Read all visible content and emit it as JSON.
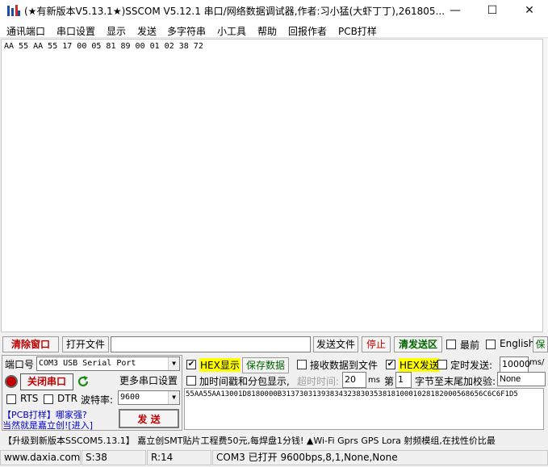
{
  "window": {
    "title": "(★有新版本V5.13.1★)SSCOM V5.12.1 串口/网络数据调试器,作者:习小猛(大虾丁丁),261805...",
    "minimize_glyph": "—",
    "maximize_glyph": "☐",
    "close_glyph": "✕"
  },
  "menu": {
    "items": [
      "通讯端口",
      "串口设置",
      "显示",
      "发送",
      "多字符串",
      "小工具",
      "帮助",
      "回报作者",
      "PCB打样"
    ]
  },
  "receive": {
    "text": "AA 55 AA 55 17 00 05 81 89 00 01 02 38 72"
  },
  "toolbar": {
    "clear_window": "清除窗口",
    "open_file": "打开文件",
    "file_path": "",
    "send_file": "发送文件",
    "stop": "停止",
    "clear_send": "清发送区",
    "top_most": "最前",
    "english": "English",
    "cut_label": "保"
  },
  "port_panel": {
    "port_label": "端口号",
    "port_value": "COM3 USB Serial Port",
    "close_port": "关闭串口",
    "more_settings": "更多串口设置",
    "rts": "RTS",
    "dtr": "DTR",
    "baud_label": "波特率:",
    "baud_value": "9600",
    "promo_line1": "【PCB打样】哪家强?",
    "promo_line2": "当然就是嘉立创![进入]",
    "send": "发  送"
  },
  "options": {
    "hex_display": "HEX显示",
    "save_data": "保存数据",
    "receive_to_file": "接收数据到文件",
    "hex_send": "HEX发送",
    "timed_send": "定时发送:",
    "timed_value": "10000",
    "timed_unit": "ms/",
    "timestamp": "加时间戳和分包显示,",
    "timeout_label": "超时时间:",
    "timeout_value": "20",
    "timeout_unit": "ms",
    "nth_label": "第",
    "nth_value": "1",
    "checksum_label": "字节至末尾加校验:",
    "checksum_value": "None"
  },
  "send_data": "55AA55AA13001D8180000B3137303139383432383035381810001028182000568656C6C6F1D5",
  "banner": "【升级到新版本SSCOM5.13.1】  嘉立创SMT贴片工程费50元,每焊盘1分钱! ▲Wi-Fi Gprs GPS Lora 射频模组,在找性价比最",
  "status": {
    "website": "www.daxia.com",
    "sent": "S:38",
    "received": "R:14",
    "port_state": "COM3 已打开  9600bps,8,1,None,None"
  }
}
